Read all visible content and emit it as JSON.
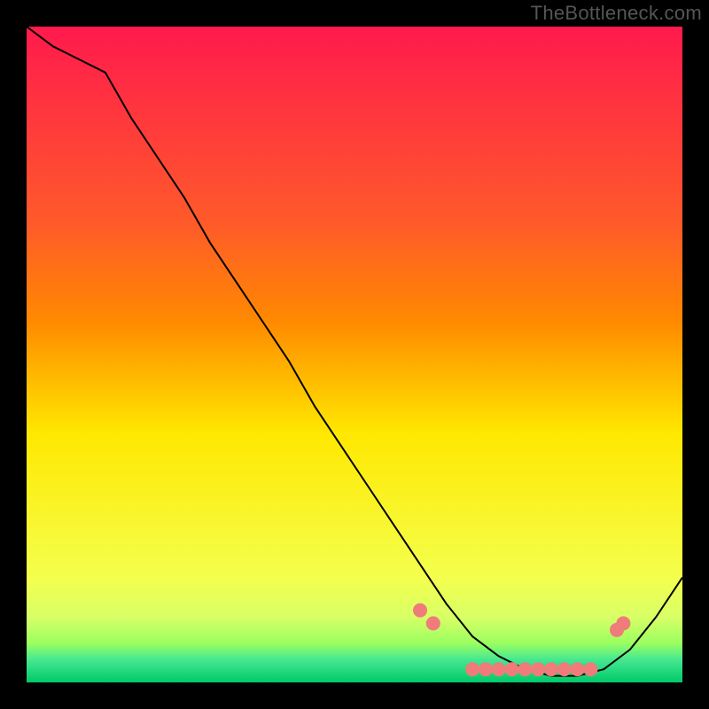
{
  "watermark": "TheBottleneck.com",
  "chart_data": {
    "type": "line",
    "title": "",
    "xlabel": "",
    "ylabel": "",
    "xlim": [
      0,
      100
    ],
    "ylim": [
      0,
      100
    ],
    "background_gradient": {
      "top": "#ff1a4d",
      "upper_mid": "#ff8a00",
      "mid": "#ffe800",
      "lower_mid": "#f4ff4d",
      "low_band": "#9cff60",
      "bottom": "#00c96a"
    },
    "series": [
      {
        "name": "bottleneck-curve",
        "color": "#000000",
        "stroke_width": 2,
        "x": [
          0,
          4,
          8,
          12,
          16,
          20,
          24,
          28,
          32,
          36,
          40,
          44,
          48,
          52,
          56,
          60,
          64,
          68,
          72,
          76,
          80,
          84,
          88,
          92,
          96,
          100
        ],
        "y": [
          100,
          97,
          95,
          93,
          86,
          80,
          74,
          67,
          61,
          55,
          49,
          42,
          36,
          30,
          24,
          18,
          12,
          7,
          4,
          2,
          1,
          1,
          2,
          5,
          10,
          16
        ]
      }
    ],
    "markers": {
      "name": "sample-points",
      "color": "#ef7b7b",
      "radius": 8,
      "x": [
        60,
        62,
        68,
        70,
        72,
        74,
        76,
        78,
        80,
        82,
        84,
        86,
        90,
        91
      ],
      "y": [
        11,
        9,
        2,
        2,
        2,
        2,
        2,
        2,
        2,
        2,
        2,
        2,
        8,
        9
      ]
    }
  }
}
